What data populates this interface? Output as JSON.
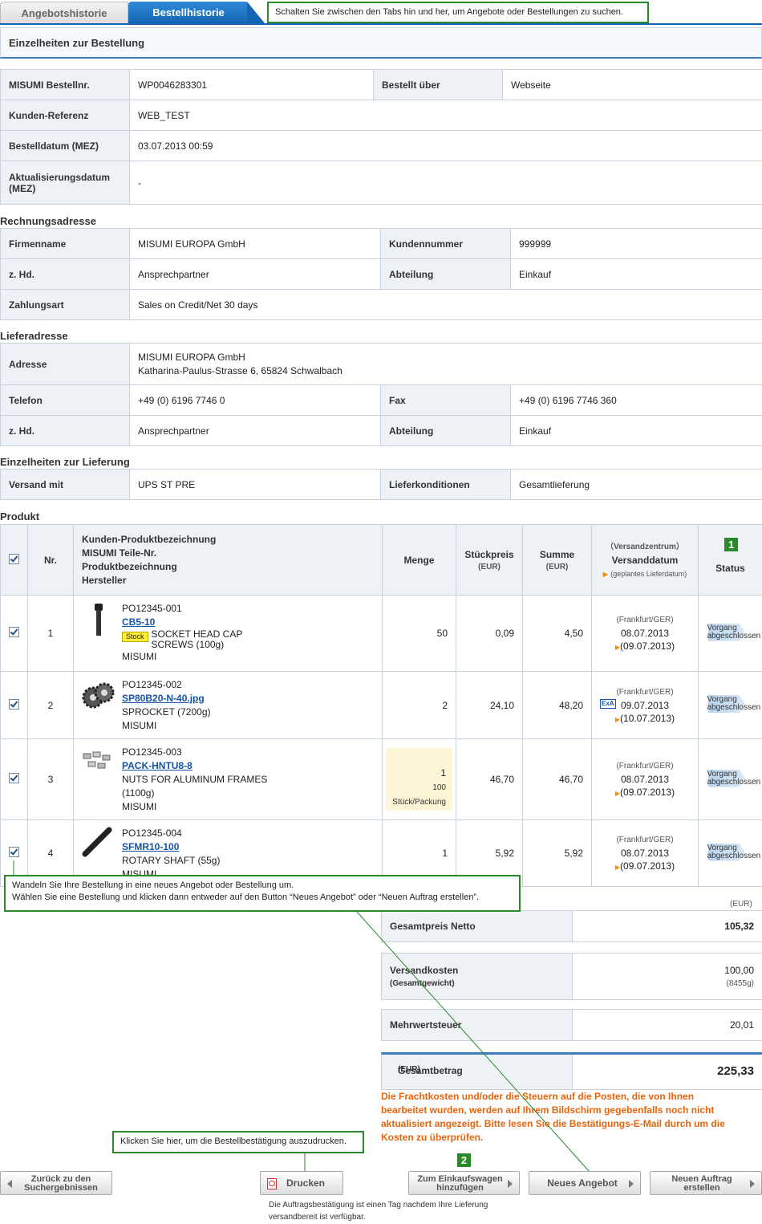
{
  "tabs": {
    "quotes": "Angebotshistorie",
    "orders": "Bestellhistorie"
  },
  "callouts": {
    "tabs": "Schalten Sie zwischen den Tabs hin und her, um Angebote oder Bestellungen zu suchen.",
    "convert_line1": "Wandeln Sie Ihre Bestellung in eine neues Angebot oder Bestellung um.",
    "convert_line2": "Wählen Sie eine Bestellung und klicken dann entweder auf  den Button “Neues Angebot” oder “Neuen Auftrag erstellen”.",
    "print": "Klicken Sie hier, um die Bestellbestätigung auszudrucken."
  },
  "page_title": "Einzelheiten zur Bestellung",
  "order": {
    "order_no_label": "MISUMI Bestellnr.",
    "order_no": "WP0046283301",
    "ordered_via_label": "Bestellt über",
    "ordered_via": "Webseite",
    "customer_ref_label": "Kunden-Referenz",
    "customer_ref": "WEB_TEST",
    "order_date_label": "Bestelldatum (MEZ)",
    "order_date": "03.07.2013 00:59",
    "update_date_label_1": "Aktualisierungsdatum",
    "update_date_label_2": "(MEZ)",
    "update_date": "-"
  },
  "billing": {
    "title": "Rechnungsadresse",
    "company_label": "Firmenname",
    "company": "MISUMI EUROPA GmbH",
    "custno_label": "Kundennummer",
    "custno": "999999",
    "attn_label": "z. Hd.",
    "attn": "Ansprechpartner",
    "dept_label": "Abteilung",
    "dept": "Einkauf",
    "payment_label": "Zahlungsart",
    "payment": "Sales on Credit/Net 30 days"
  },
  "shipping": {
    "title": "Lieferadresse",
    "address_label": "Adresse",
    "address_line1": "MISUMI EUROPA GmbH",
    "address_line2": "Katharina-Paulus-Strasse 6, 65824 Schwalbach",
    "phone_label": "Telefon",
    "phone": "+49 (0) 6196 7746 0",
    "fax_label": "Fax",
    "fax": "+49 (0) 6196 7746 360",
    "attn_label": "z. Hd.",
    "attn": "Ansprechpartner",
    "dept_label": "Abteilung",
    "dept": "Einkauf"
  },
  "delivery": {
    "title": "Einzelheiten zur Lieferung",
    "carrier_label": "Versand mit",
    "carrier": "UPS ST PRE",
    "terms_label": "Lieferkonditionen",
    "terms": "Gesamtlieferung"
  },
  "product": {
    "title": "Produkt",
    "headers": {
      "no": "Nr.",
      "desc1": "Kunden-Produktbezeichnung",
      "desc2": "MISUMI Teile-Nr.",
      "desc3": "Produktbezeichnung",
      "desc4": "Hersteller",
      "qty": "Menge",
      "unit": "Stückpreis",
      "unit_cur": "(EUR)",
      "sum": "Summe",
      "sum_cur": "(EUR)",
      "center": "（Versandzentrum）",
      "ship_date": "Versanddatum",
      "planned": "(geplantes Lieferdatum)",
      "status": "Status",
      "badge1": "1"
    },
    "rows": [
      {
        "no": "1",
        "cust": "PO12345-001",
        "part": "CB5-10",
        "stock": "Stock",
        "name": "SOCKET HEAD CAP SCREWS (100g)",
        "mfr": "MISUMI",
        "qty": "50",
        "unit": "0,09",
        "sum": "4,50",
        "center": "(Frankfurt/GER)",
        "date": "08.07.2013",
        "planned": "(09.07.2013)",
        "status1": "Vorgang",
        "status2": "abgeschlossen"
      },
      {
        "no": "2",
        "cust": "PO12345-002",
        "part": "SP80B20-N-40.jpg",
        "name": "SPROCKET (7200g)",
        "mfr": "MISUMI",
        "qty": "2",
        "unit": "24,10",
        "sum": "48,20",
        "center": "(Frankfurt/GER)",
        "exa": "ExA",
        "date": "09.07.2013",
        "planned": "(10.07.2013)",
        "status1": "Vorgang",
        "status2": "abgeschlossen"
      },
      {
        "no": "3",
        "cust": "PO12345-003",
        "part": "PACK-HNTU8-8",
        "name": "NUTS FOR ALUMINUM FRAMES",
        "name2": "(1100g)",
        "mfr": "MISUMI",
        "qty": "1",
        "qty2": "100",
        "qty3": "Stück/Packung",
        "unit": "46,70",
        "sum": "46,70",
        "center": "(Frankfurt/GER)",
        "date": "08.07.2013",
        "planned": "(09.07.2013)",
        "status1": "Vorgang",
        "status2": "abgeschlossen"
      },
      {
        "no": "4",
        "cust": "PO12345-004",
        "part": "SFMR10-100",
        "name": "ROTARY SHAFT (55g)",
        "mfr": "MISUMI",
        "qty": "1",
        "unit": "5,92",
        "sum": "5,92",
        "center": "(Frankfurt/GER)",
        "date": "08.07.2013",
        "planned": "(09.07.2013)",
        "status1": "Vorgang",
        "status2": "abgeschlossen"
      }
    ]
  },
  "totals": {
    "currency": "(EUR)",
    "net_label": "Gesamtpreis Netto",
    "net": "105,32",
    "ship_label": "Versandkosten",
    "ship_sub": "(Gesamtgewicht)",
    "ship": "100,00",
    "weight": "(8455g)",
    "vat_label": "Mehrwertsteuer",
    "vat": "20,01",
    "grand_label": "Gesamtbetrag",
    "grand_cur": "(EUR)",
    "grand": "225,33",
    "note": "Die Frachtkosten und/oder die Steuern auf die Posten, die von Ihnen bearbeitet wurden, werden auf Ihrem Bildschirm gegebenfalls noch nicht aktualisiert angezeigt. Bitte lesen Sie die Bestätigungs-E-Mail durch um die Kosten zu überprüfen."
  },
  "buttons": {
    "back1": "Zurück zu den",
    "back2": "Suchergebnissen",
    "print": "Drucken",
    "cart1": "Zum Einkaufswagen",
    "cart2": "hinzufügen",
    "badge2": "2",
    "new_quote": "Neues Angebot",
    "new_order1": "Neuen Auftrag",
    "new_order2": "erstellen"
  },
  "print_note": "Die Auftragsbestätigung ist einen Tag nachdem Ihre Lieferung versandbereit ist verfügbar.",
  "colors": {
    "accent": "#1565b3",
    "callout_border": "#2a8a2a",
    "note": "#e8640c"
  }
}
